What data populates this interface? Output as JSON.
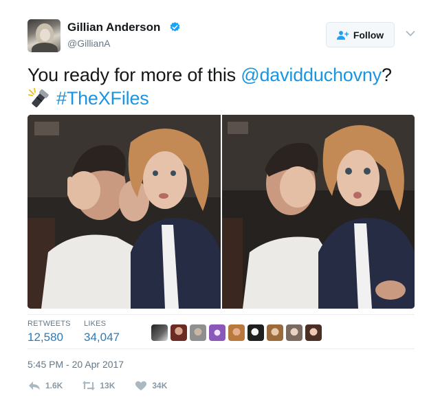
{
  "author": {
    "display_name": "Gillian Anderson",
    "handle": "@GillianA"
  },
  "follow_button": {
    "label": "Follow"
  },
  "tweet": {
    "text_before": "You ready for more of this ",
    "mention": "@davidduchovny",
    "text_after": "?",
    "hashtag": "#TheXFiles"
  },
  "stats": {
    "retweets_label": "RETWEETS",
    "retweets_value": "12,580",
    "likes_label": "LIKES",
    "likes_value": "34,047"
  },
  "timestamp": "5:45 PM - 20 Apr 2017",
  "actions": {
    "reply_count": "1.6K",
    "retweet_count": "13K",
    "like_count": "34K"
  },
  "colors": {
    "link": "#1b95e0",
    "secondary_text": "#657786",
    "verified": "#1da1f2"
  }
}
